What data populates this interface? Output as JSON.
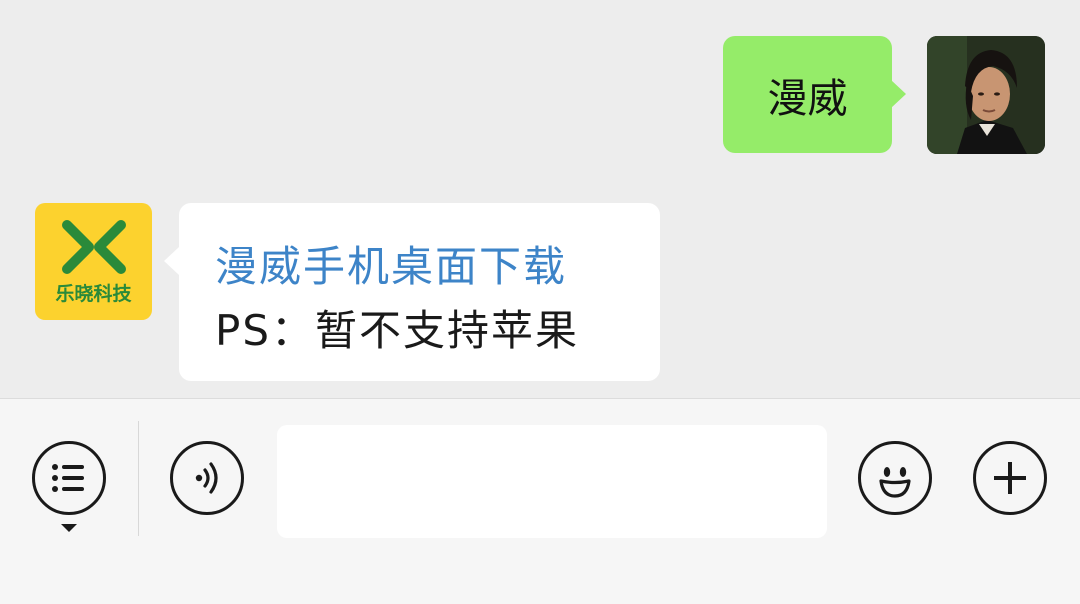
{
  "messages": {
    "outgoing": {
      "text": "漫威",
      "avatar": "user-avatar-photo"
    },
    "incoming": {
      "avatar": "lexiao-tech-logo",
      "avatar_label": "乐晓科技",
      "link_text": "漫威手机桌面下载",
      "text": "PS：暂不支持苹果"
    }
  },
  "toolbar": {
    "menu_icon": "list-menu-icon",
    "voice_icon": "voice-icon",
    "input_placeholder": "",
    "emoji_icon": "emoji-icon",
    "plus_icon": "plus-icon"
  },
  "colors": {
    "background": "#ededed",
    "outgoing_bubble": "#95ec69",
    "incoming_bubble": "#ffffff",
    "link": "#3d84c8",
    "brand_yellow": "#fcd22e",
    "brand_green": "#2a8a3a"
  }
}
